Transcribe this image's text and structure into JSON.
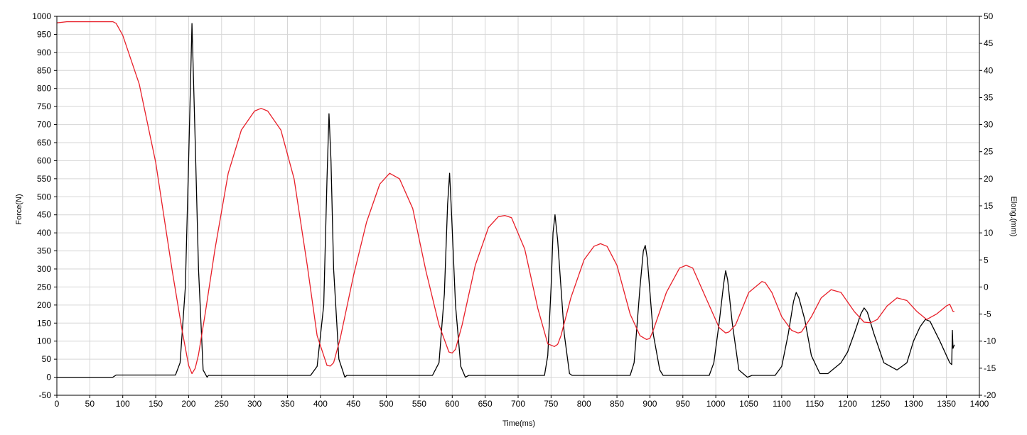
{
  "chart_data": {
    "type": "line",
    "xlabel": "Time(ms)",
    "ylabel": "Force(N)",
    "y2label": "Elong.(mm)",
    "xlim": [
      0,
      1400
    ],
    "ylim": [
      -50,
      1000
    ],
    "y2lim": [
      -20,
      50
    ],
    "grid": true,
    "x_ticks": [
      0,
      50,
      100,
      150,
      200,
      250,
      300,
      350,
      400,
      450,
      500,
      550,
      600,
      650,
      700,
      750,
      800,
      850,
      900,
      950,
      1000,
      1050,
      1100,
      1150,
      1200,
      1250,
      1300,
      1350,
      1400
    ],
    "y_ticks": [
      -50,
      0,
      50,
      100,
      150,
      200,
      250,
      300,
      350,
      400,
      450,
      500,
      550,
      600,
      650,
      700,
      750,
      800,
      850,
      900,
      950,
      1000
    ],
    "y2_ticks": [
      -20,
      -15,
      -10,
      -5,
      0,
      5,
      10,
      15,
      20,
      25,
      30,
      35,
      40,
      45,
      50
    ],
    "series": [
      {
        "axis": "left",
        "color": "#000000",
        "x": [
          0,
          85,
          90,
          180,
          187,
          195,
          200,
          205,
          210,
          215,
          222,
          228,
          230,
          385,
          395,
          405,
          410,
          413,
          416,
          420,
          428,
          437,
          440,
          570,
          580,
          588,
          593,
          596,
          599,
          605,
          613,
          620,
          625,
          740,
          745,
          750,
          753,
          756,
          760,
          770,
          778,
          782,
          870,
          876,
          885,
          890,
          893,
          896,
          905,
          915,
          920,
          990,
          997,
          1005,
          1012,
          1015,
          1018,
          1025,
          1035,
          1048,
          1055,
          1090,
          1100,
          1110,
          1118,
          1122,
          1126,
          1135,
          1145,
          1158,
          1170,
          1190,
          1200,
          1210,
          1220,
          1225,
          1230,
          1240,
          1255,
          1275,
          1290,
          1300,
          1310,
          1318,
          1325,
          1340,
          1355,
          1358,
          1359,
          1360,
          1362
        ],
        "y": [
          0,
          0,
          6,
          6,
          40,
          250,
          600,
          980,
          650,
          300,
          20,
          0,
          5,
          5,
          30,
          200,
          550,
          730,
          600,
          300,
          50,
          0,
          5,
          5,
          40,
          230,
          480,
          565,
          450,
          200,
          30,
          0,
          5,
          5,
          60,
          250,
          400,
          450,
          380,
          120,
          10,
          5,
          5,
          40,
          250,
          350,
          365,
          330,
          120,
          20,
          5,
          5,
          40,
          150,
          260,
          295,
          270,
          150,
          20,
          0,
          5,
          5,
          30,
          120,
          210,
          235,
          220,
          160,
          60,
          10,
          10,
          40,
          70,
          120,
          175,
          192,
          180,
          120,
          40,
          20,
          40,
          100,
          140,
          160,
          155,
          100,
          40,
          35,
          130,
          80,
          90
        ]
      },
      {
        "axis": "right",
        "color": "#e8202a",
        "x": [
          0,
          15,
          85,
          90,
          100,
          125,
          150,
          175,
          190,
          200,
          205,
          210,
          215,
          225,
          240,
          260,
          280,
          300,
          310,
          320,
          340,
          360,
          380,
          395,
          410,
          415,
          420,
          430,
          450,
          470,
          490,
          505,
          520,
          540,
          560,
          580,
          595,
          600,
          605,
          615,
          635,
          655,
          670,
          680,
          690,
          710,
          730,
          745,
          755,
          760,
          765,
          780,
          800,
          815,
          825,
          835,
          850,
          870,
          885,
          895,
          900,
          905,
          925,
          945,
          955,
          965,
          985,
          1005,
          1015,
          1020,
          1030,
          1050,
          1070,
          1075,
          1085,
          1100,
          1115,
          1125,
          1130,
          1145,
          1160,
          1175,
          1190,
          1210,
          1225,
          1235,
          1245,
          1260,
          1275,
          1290,
          1305,
          1320,
          1335,
          1350,
          1355,
          1358,
          1360,
          1362
        ],
        "y": [
          48.8,
          49.0,
          49.0,
          48.7,
          46.5,
          37.5,
          23,
          3,
          -8,
          -14.5,
          -16,
          -15,
          -12.5,
          -5,
          7,
          21,
          29,
          32.5,
          33,
          32.5,
          29,
          20,
          4,
          -9,
          -14.5,
          -14.6,
          -14,
          -9.5,
          2,
          12,
          19,
          21,
          20,
          14.5,
          3,
          -7,
          -12,
          -12.2,
          -11.5,
          -7,
          4,
          11,
          13,
          13.2,
          12.8,
          7,
          -4,
          -10.5,
          -11,
          -10.6,
          -9,
          -2,
          5,
          7.5,
          8,
          7.5,
          4,
          -5,
          -9,
          -9.7,
          -9.5,
          -8,
          -1,
          3.5,
          4,
          3.5,
          -2,
          -7.5,
          -8.5,
          -8.3,
          -7,
          -1,
          1,
          0.8,
          -1,
          -5.5,
          -8,
          -8.5,
          -8.3,
          -5.5,
          -2,
          -0.5,
          -1,
          -4.5,
          -6.5,
          -6.6,
          -6,
          -3.5,
          -2,
          -2.5,
          -4.5,
          -6,
          -5,
          -3.5,
          -3.2,
          -4,
          -4.5,
          -4.5
        ]
      }
    ]
  }
}
